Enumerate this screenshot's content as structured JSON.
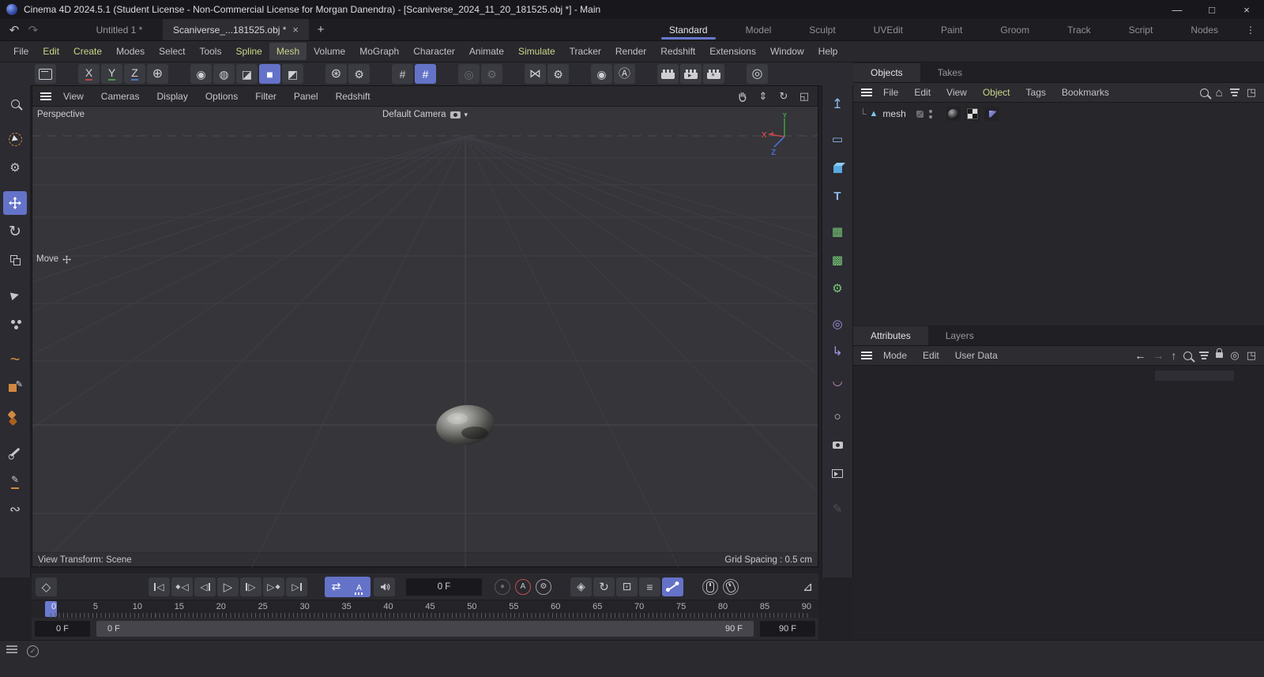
{
  "titlebar": {
    "title": "Cinema 4D 2024.5.1 (Student License - Non-Commercial License for Morgan Danendra) - [Scaniverse_2024_11_20_181525.obj *] - Main"
  },
  "tabbar": {
    "documents": [
      {
        "label": "Untitled 1 *"
      },
      {
        "label": "Scaniverse_...181525.obj *"
      }
    ],
    "workspaces": [
      "Standard",
      "Model",
      "Sculpt",
      "UVEdit",
      "Paint",
      "Groom",
      "Track",
      "Script",
      "Nodes"
    ],
    "active_workspace": "Standard"
  },
  "menubar": {
    "items": [
      {
        "label": "File"
      },
      {
        "label": "Edit",
        "accent": true
      },
      {
        "label": "Create",
        "accent": true
      },
      {
        "label": "Modes"
      },
      {
        "label": "Select"
      },
      {
        "label": "Tools"
      },
      {
        "label": "Spline",
        "accent": true
      },
      {
        "label": "Mesh",
        "accent": true,
        "active": true
      },
      {
        "label": "Volume"
      },
      {
        "label": "MoGraph"
      },
      {
        "label": "Character"
      },
      {
        "label": "Animate"
      },
      {
        "label": "Simulate",
        "accent": true
      },
      {
        "label": "Tracker"
      },
      {
        "label": "Render"
      },
      {
        "label": "Redshift"
      },
      {
        "label": "Extensions"
      },
      {
        "label": "Window"
      },
      {
        "label": "Help"
      }
    ]
  },
  "toolbar": {
    "groups": [
      [
        {
          "name": "box-tool",
          "css": "box"
        }
      ],
      [
        {
          "name": "lock-x-axis",
          "label": "X",
          "underline": "#b84848"
        },
        {
          "name": "lock-y-axis",
          "label": "Y",
          "underline": "#4a9a4a"
        },
        {
          "name": "lock-z-axis",
          "label": "Z",
          "underline": "#4878c8"
        },
        {
          "name": "coordinate-system",
          "glyph": "⊕",
          "size": 16
        }
      ],
      [
        {
          "name": "points-mode",
          "glyph": "◉"
        },
        {
          "name": "edges-mode",
          "glyph": "◍"
        },
        {
          "name": "polygons-mode",
          "glyph": "◪"
        },
        {
          "name": "model-mode",
          "glyph": "■",
          "active": true
        },
        {
          "name": "object-mode",
          "glyph": "◩"
        }
      ],
      [
        {
          "name": "axis-modify",
          "glyph": "⊛",
          "size": 16
        },
        {
          "name": "axis-settings",
          "glyph": "⚙"
        }
      ],
      [
        {
          "name": "quantize-grid",
          "glyph": "#"
        },
        {
          "name": "quantize-grid-lock",
          "glyph": "#",
          "active": true
        }
      ],
      [
        {
          "name": "modeling-axis",
          "glyph": "◎",
          "disabled": true
        },
        {
          "name": "modeling-settings",
          "glyph": "⚙",
          "disabled": true
        }
      ],
      [
        {
          "name": "symmetry",
          "glyph": "⋈",
          "size": 15
        },
        {
          "name": "symmetry-settings",
          "glyph": "⚙"
        }
      ],
      [
        {
          "name": "viewport-solo",
          "glyph": "◉"
        },
        {
          "name": "auto-mode",
          "glyph": "Ⓐ",
          "size": 15
        }
      ],
      [
        {
          "name": "render-view",
          "css": "clap"
        },
        {
          "name": "render-picture-viewer",
          "css": "clap v2"
        },
        {
          "name": "render-settings",
          "css": "clap v3"
        }
      ],
      [
        {
          "name": "render-queue",
          "glyph": "◎",
          "size": 16
        }
      ]
    ]
  },
  "left_tools": [
    {
      "name": "commander-search-tool",
      "css": "mag"
    },
    {
      "name": "live-selection-tool",
      "css": "livesel",
      "gapBefore": true
    },
    {
      "name": "tool-settings-cursor",
      "glyph": "⚙",
      "size": 15
    },
    {
      "name": "move-tool",
      "svg": "s-move",
      "active": true,
      "gapBefore": true
    },
    {
      "name": "rotate-tool",
      "glyph": "↻",
      "size": 19
    },
    {
      "name": "scale-tool",
      "css": "scale"
    },
    {
      "name": "tweak-move-tool",
      "css": "tweak",
      "gapBefore": true
    },
    {
      "name": "tweak-multi-tool",
      "css": "tweakmulti"
    },
    {
      "name": "spline-smooth-tool",
      "glyph": "~",
      "color": "#d08840",
      "size": 22,
      "gapBefore": true
    },
    {
      "name": "polygon-pen-tool",
      "css": "sqpen"
    },
    {
      "name": "multi-pen-tool",
      "css": "hexpen"
    },
    {
      "name": "brush-tool",
      "css": "brush",
      "gapBefore": true
    },
    {
      "name": "knife-tool",
      "css": "knife"
    },
    {
      "name": "spline-sketch-tool",
      "glyph": "∾",
      "size": 17
    }
  ],
  "right_tools": [
    {
      "name": "spline-pen-object",
      "glyph": "↥",
      "color": "#8fb8e8",
      "size": 17
    },
    {
      "name": "spline-primitive-object",
      "glyph": "▭",
      "color": "#8fb8e8",
      "size": 15,
      "gapBefore": true
    },
    {
      "name": "primitive-cube-object",
      "css": "cube"
    },
    {
      "name": "text-object",
      "glyph": "T",
      "color": "#8fb8e8",
      "size": 15,
      "bold": true
    },
    {
      "name": "mograph-cloner-object",
      "glyph": "▦",
      "color": "#79c879",
      "size": 15,
      "gapBefore": true
    },
    {
      "name": "volume-builder-object",
      "glyph": "▩",
      "color": "#79c879",
      "size": 15
    },
    {
      "name": "generator-object",
      "glyph": "⚙",
      "color": "#79c879",
      "size": 15
    },
    {
      "name": "field-object",
      "glyph": "◎",
      "color": "#a295e0",
      "size": 15,
      "gapBefore": true
    },
    {
      "name": "spline-arc-object",
      "glyph": "↳",
      "color": "#a295e0",
      "size": 16
    },
    {
      "name": "deformer-object",
      "glyph": "◡",
      "color": "#c690cc",
      "size": 15
    },
    {
      "name": "environment-object",
      "glyph": "○",
      "color": "#d0d0d4",
      "size": 15,
      "gapBefore": true
    },
    {
      "name": "camera-object",
      "css": "cam"
    },
    {
      "name": "stage-object",
      "css": "stage"
    },
    {
      "name": "paint-tool",
      "glyph": "✎",
      "size": 15,
      "disabled": true,
      "gapBefore": true
    }
  ],
  "viewport": {
    "menu": [
      "View",
      "Cameras",
      "Display",
      "Options",
      "Filter",
      "Panel",
      "Redshift"
    ],
    "view_label": "Perspective",
    "camera_label": "Default Camera",
    "tool_label": "Move",
    "status_left": "View Transform: Scene",
    "status_right": "Grid Spacing : 0.5 cm",
    "axis": {
      "x": "X",
      "y": "Y",
      "z": "Z"
    }
  },
  "object_manager": {
    "tabs": [
      {
        "label": "Objects",
        "active": true
      },
      {
        "label": "Takes"
      }
    ],
    "menu": [
      {
        "label": "File"
      },
      {
        "label": "Edit"
      },
      {
        "label": "View"
      },
      {
        "label": "Object",
        "accent": true
      },
      {
        "label": "Tags"
      },
      {
        "label": "Bookmarks"
      }
    ],
    "item_name": "mesh"
  },
  "attributes": {
    "tabs": [
      {
        "label": "Attributes",
        "active": true
      },
      {
        "label": "Layers"
      }
    ],
    "menu": [
      {
        "label": "Mode"
      },
      {
        "label": "Edit"
      },
      {
        "label": "User Data"
      }
    ]
  },
  "timeline": {
    "frame_labels": [
      "0",
      "5",
      "10",
      "15",
      "20",
      "25",
      "30",
      "35",
      "40",
      "45",
      "50",
      "55",
      "60",
      "65",
      "70",
      "75",
      "80",
      "85",
      "90"
    ],
    "current_frame": "0 F",
    "range_input_start": "0 F",
    "range_input_end": "90 F",
    "range_bar_start": "0 F",
    "range_bar_end": "90 F"
  },
  "icons": {
    "undo": "↶",
    "redo": "↷",
    "close": "×",
    "close_tab": "×",
    "add": "+",
    "dots": "⋮",
    "minimize": "—",
    "maximize": "□",
    "dolly": "⇕",
    "orbit": "↻",
    "maximize_view": "◱",
    "camera_dropdown": "▾",
    "home": "⌂",
    "popout": "◳",
    "back": "←",
    "forward": "→",
    "up": "↑",
    "target": "◎",
    "tri_left": "◁",
    "tri_right": "▷",
    "key": "◆",
    "key_outline": "◇",
    "loop": "⇄",
    "rec": "●",
    "autokey": "A",
    "gear": "⚙",
    "pos": "◈",
    "rot": "↻",
    "scl": "⊡",
    "par": "≡",
    "fcurve": "⊿",
    "check": "✓",
    "tree_elbow": "└",
    "mesh": "▲"
  }
}
